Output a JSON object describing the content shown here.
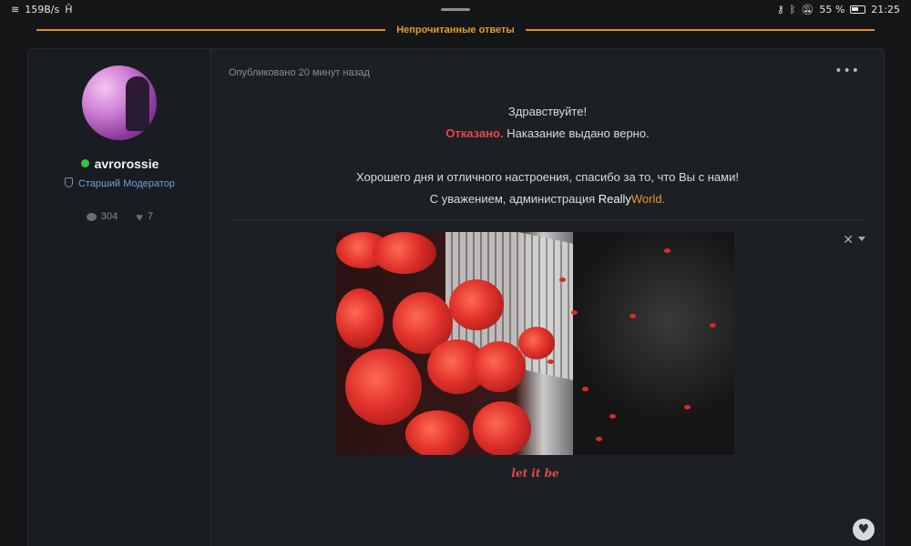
{
  "status_bar": {
    "speed": "159B/s",
    "battery": "55 %",
    "time": "21:25"
  },
  "divider": {
    "label": "Непрочитанные ответы"
  },
  "author": {
    "name": "avrorossie",
    "role": "Старший Модератор",
    "posts_count": "304",
    "likes_count": "7"
  },
  "post": {
    "meta": "Опубликовано 20 минут назад",
    "more_icon": "•••",
    "greeting": "Здравствуйте!",
    "verdict": "Отказано.",
    "verdict_rest": " Наказание выдано верно.",
    "wish": "Хорошего дня и отличного настроения, спасибо за то, что Вы с нами!",
    "signature_prefix": "С уважением, администрация ",
    "brand_part1": "Really",
    "brand_part2": "World",
    "brand_suffix": ".",
    "caption": "let it be"
  },
  "colors": {
    "accent_orange": "#e38c14",
    "online_green": "#35c14a",
    "role_blue": "#6fa0e0",
    "verdict_red": "#e8474c"
  },
  "icons": {
    "comment": "comment-icon",
    "heart": "heart-icon",
    "shield": "shield-icon",
    "close": "close-icon",
    "like": "like-button"
  }
}
